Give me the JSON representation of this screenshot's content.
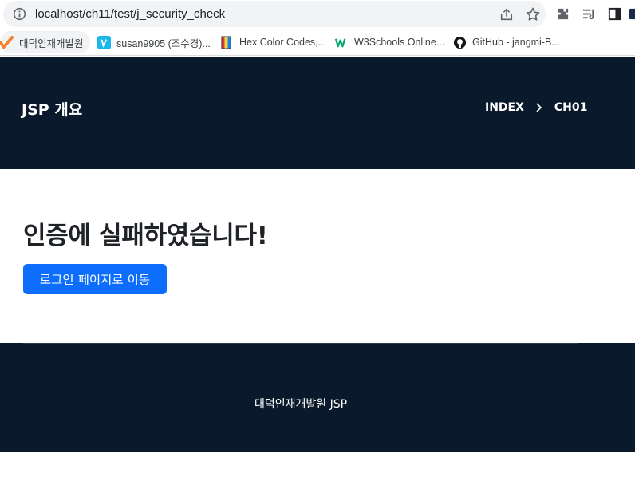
{
  "browser": {
    "url": "localhost/ch11/test/j_security_check",
    "bookmarks": [
      {
        "label": "대덕인재개발원",
        "icon": "orange-check-icon",
        "color": "#f5822a"
      },
      {
        "label": "susan9905 (조수경)...",
        "icon": "vimeo-icon",
        "color": "#1ab7ea"
      },
      {
        "label": "Hex Color Codes,...",
        "icon": "color-book-icon",
        "color": "#d33"
      },
      {
        "label": "W3Schools Online...",
        "icon": "w3schools-icon",
        "color": "#04aa6d"
      },
      {
        "label": "GitHub - jangmi-B...",
        "icon": "github-icon",
        "color": "#181717"
      }
    ]
  },
  "header": {
    "brand": "JSP 개요",
    "breadcrumb": [
      "INDEX",
      "CH01"
    ],
    "background": "#0a192b"
  },
  "main": {
    "title": "인증에 실패하였습니다!",
    "button_label": "로그인 페이지로 이동",
    "button_color": "#0d6efd"
  },
  "footer": {
    "text": "대덕인재개발원 JSP"
  }
}
